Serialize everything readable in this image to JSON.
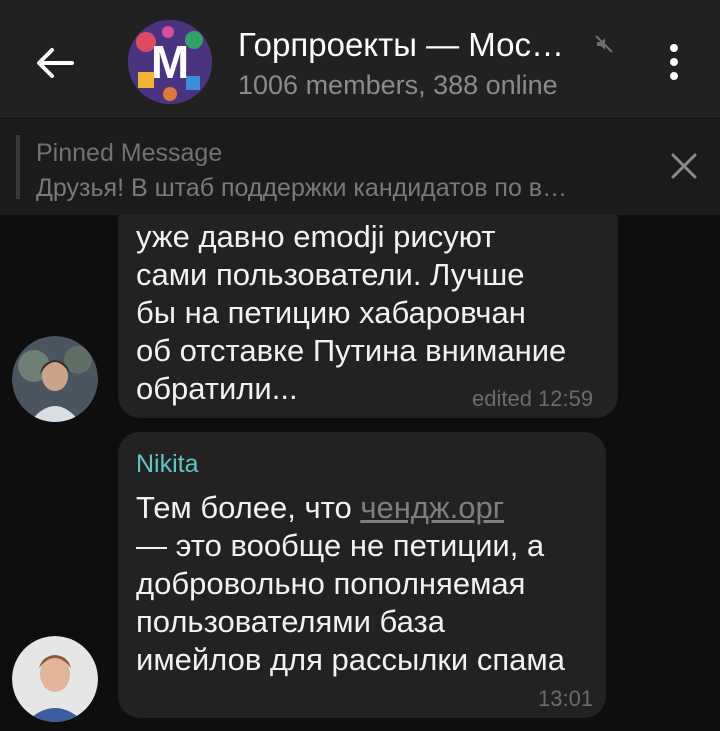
{
  "header": {
    "title": "Горпроекты — Мос…",
    "subtitle": "1006 members, 388 online",
    "group_avatar_letter": "M",
    "icons": {
      "back": "arrow-left-icon",
      "mute": "muted-icon",
      "menu": "more-vertical-icon"
    }
  },
  "pinned": {
    "title": "Pinned Message",
    "text": "Друзья! В штаб поддержки кандидатов по в…",
    "close_icon": "close-icon"
  },
  "messages": [
    {
      "lines": [
        "уже давно emodji рисуют",
        "сами пользователи. Лучше",
        "бы на петицию хабаровчан",
        "об отставке Путина внимание",
        "обратили..."
      ],
      "time": "edited 12:59"
    },
    {
      "sender": "Nikita",
      "line1_prefix": "Тем более, что ",
      "line1_link": "чендж.орг",
      "lines": [
        "— это вообще не петиции, а",
        "добровольно пополняемая",
        "пользователями база",
        "имейлов для рассылки спама"
      ],
      "time": "13:01"
    }
  ],
  "colors": {
    "header_bg": "#212121",
    "chat_bg": "#0e0e0e",
    "bubble_bg": "#222222",
    "sender_name": "#5fc6c4"
  }
}
